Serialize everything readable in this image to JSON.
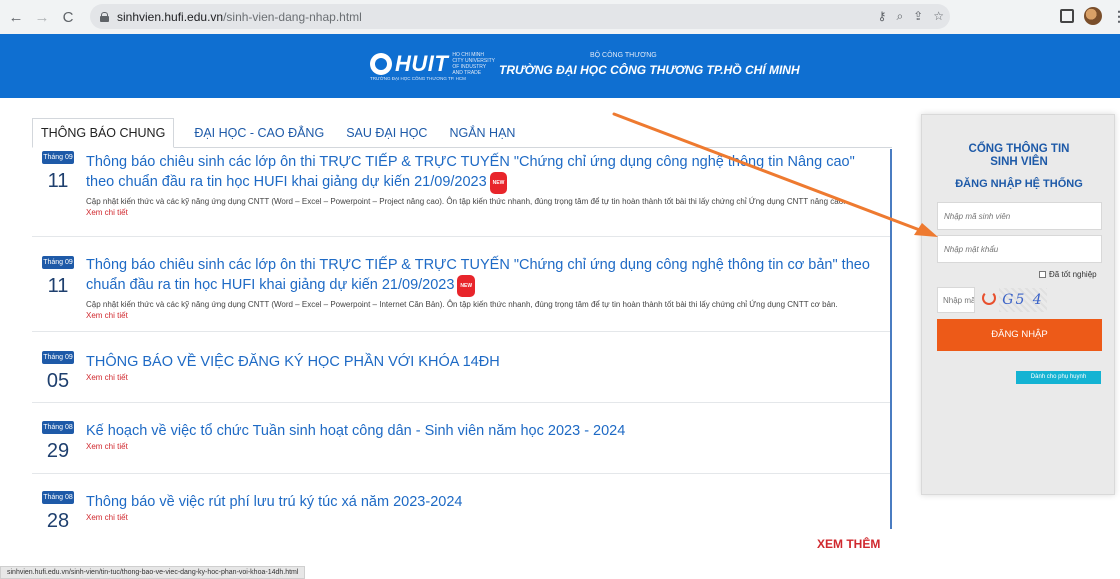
{
  "browser": {
    "url_host": "sinhvien.hufi.edu.vn",
    "url_path": "/sinh-vien-dang-nhap.html",
    "back_glyph": "←",
    "forward_glyph": "→",
    "reload_glyph": "C",
    "key_glyph": "⚷",
    "zoom_glyph": "⌕",
    "share_glyph": "⇪",
    "star_glyph": "☆",
    "menu_glyph": "⋮"
  },
  "header": {
    "brand": "HUIT",
    "brand_sub": "HO CHI MINH CITY UNIVERSITY OF INDUSTRY AND TRADE",
    "brand_tag": "TRƯỜNG ĐẠI HỌC CÔNG THƯƠNG TP. HCM",
    "ministry": "BỘ CÔNG THƯƠNG",
    "school": "TRƯỜNG ĐẠI HỌC CÔNG THƯƠNG TP.HỒ CHÍ MINH"
  },
  "tabs": [
    {
      "label": "THÔNG BÁO CHUNG"
    },
    {
      "label": "ĐẠI HỌC - CAO ĐẲNG"
    },
    {
      "label": "SAU ĐẠI HỌC"
    },
    {
      "label": "NGẮN HẠN"
    }
  ],
  "news": [
    {
      "month": "Tháng 09",
      "day": "11",
      "title": "Thông báo chiêu sinh các lớp ôn thi TRỰC TIẾP & TRỰC TUYẾN \"Chứng chỉ ứng dụng công nghệ thông tin Nâng cao\" theo chuẩn đầu ra tin học HUFI khai giảng dự kiến 21/09/2023",
      "badge": "NEW",
      "desc": "Cập nhật kiến thức và các kỹ năng ứng dụng CNTT (Word – Excel – Powerpoint – Project nâng cao). Ôn tập kiến thức nhanh, đúng trọng tâm để tự tin hoàn thành tốt bài thi lấy chứng chỉ Ứng dụng CNTT nâng cao.",
      "more": "Xem chi tiết"
    },
    {
      "month": "Tháng 09",
      "day": "11",
      "title": "Thông báo chiêu sinh các lớp ôn thi TRỰC TIẾP & TRỰC TUYẾN \"Chứng chỉ ứng dụng công nghệ thông tin cơ bản\" theo chuẩn đầu ra tin học HUFI khai giảng dự kiến 21/09/2023",
      "badge": "NEW",
      "desc": "Cập nhật kiến thức và các kỹ năng ứng dụng CNTT (Word – Excel – Powerpoint – Internet Căn Bản). Ôn tập kiến thức nhanh, đúng trọng tâm để tự tin hoàn thành tốt bài thi lấy chứng chỉ Ứng dụng CNTT cơ bản.",
      "more": "Xem chi tiết"
    },
    {
      "month": "Tháng 09",
      "day": "05",
      "title": "THÔNG BÁO VỀ VIỆC ĐĂNG KÝ HỌC PHẦN VỚI KHÓA 14ĐH",
      "more": "Xem chi tiết"
    },
    {
      "month": "Tháng 08",
      "day": "29",
      "title": "Kế hoạch về việc tổ chức Tuần sinh hoạt công dân - Sinh viên năm học 2023 - 2024",
      "more": "Xem chi tiết"
    },
    {
      "month": "Tháng 08",
      "day": "28",
      "title": "Thông báo về việc rút phí lưu trú ký túc xá năm 2023-2024",
      "more": "Xem chi tiết"
    }
  ],
  "xem_them": "XEM THÊM",
  "login": {
    "title_line1": "CỔNG THÔNG TIN",
    "title_line2": "SINH VIÊN",
    "subtitle": "ĐĂNG NHẬP HỆ THỐNG",
    "student_id_placeholder": "Nhập mã sinh viên",
    "password_placeholder": "Nhập mật khẩu",
    "graduated_label": "Đã tốt nghiệp",
    "captcha_placeholder": "Nhập mã",
    "captcha_text": "G5 4",
    "login_button": "ĐĂNG NHẬP",
    "parent_button": "Dành cho phụ huynh"
  },
  "status_url": "sinhvien.hufi.edu.vn/sinh-vien/tin-tuc/thong-bao-ve-viec-dang-ky-hoc-phan-voi-khoa-14dh.html",
  "colors": {
    "banner": "#0f6fd1",
    "link": "#1e6ac5",
    "accent_red": "#d0282e",
    "login_orange": "#ed5a18",
    "parent_cyan": "#14b3d3",
    "annotation_arrow": "#ee7a30"
  }
}
